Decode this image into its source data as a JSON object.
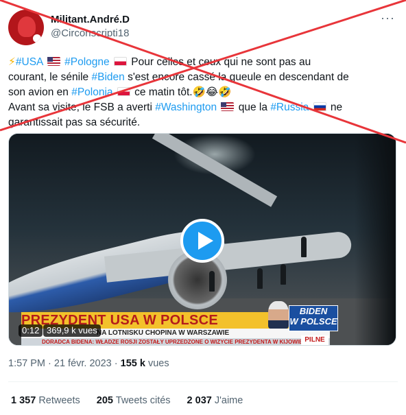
{
  "author": {
    "display_name": "Militant.André.D",
    "handle": "@Circonscripti18"
  },
  "more_icon": "ellipsis-icon",
  "tweet": {
    "line1": {
      "bolt": "⚡",
      "tag_usa": "#USA",
      "tag_pologne": "#Pologne",
      "text": " Pour celles et ceux qui ne sont pas au"
    },
    "line2": {
      "text_a": "courant, le sénile ",
      "tag_biden": "#Biden",
      "text_b": " s'est encore cassé la gueule en descendant de"
    },
    "line3": {
      "text_a": "son avion en ",
      "tag_polonia": "#Polonia",
      "text_b": " ce matin tôt.",
      "emoji": "🤣😂🤣"
    },
    "line4": {
      "text_a": "Avant sa visite, le FSB a averti ",
      "tag_washington": "#Washington",
      "text_b": " que la ",
      "tag_russia": "#Russia",
      "text_c": " ne"
    },
    "line5": {
      "text": "garantissait pas sa sécurité."
    }
  },
  "video": {
    "duration": "0:12",
    "views": "369,9 k vues",
    "headline": "PREZYDENT USA W POLSCE",
    "subheadline": "NA LOTNISKU CHOPINA W WARSZAWIE",
    "ticker": "DORADCA BIDENA: WŁADZE ROSJI ZOSTAŁY UPRZEDZONE O WIZYCIE PREZYDENTA W KIJOWIE",
    "logo_line1": "BIDEN",
    "logo_line2": "W POLSCE",
    "pilne": "PILNE"
  },
  "meta": {
    "timestamp": "1:57 PM · 21 févr. 2023 · ",
    "views_count": "155 k",
    "views_label": " vues"
  },
  "stats": {
    "retweets_count": "1 357",
    "retweets_label": "Retweets",
    "quotes_count": "205",
    "quotes_label": "Tweets cités",
    "likes_count": "2 037",
    "likes_label": "J'aime"
  },
  "colors": {
    "link": "#1d9bf0",
    "cross": "#e8353a",
    "banner": "#f3c12b"
  }
}
